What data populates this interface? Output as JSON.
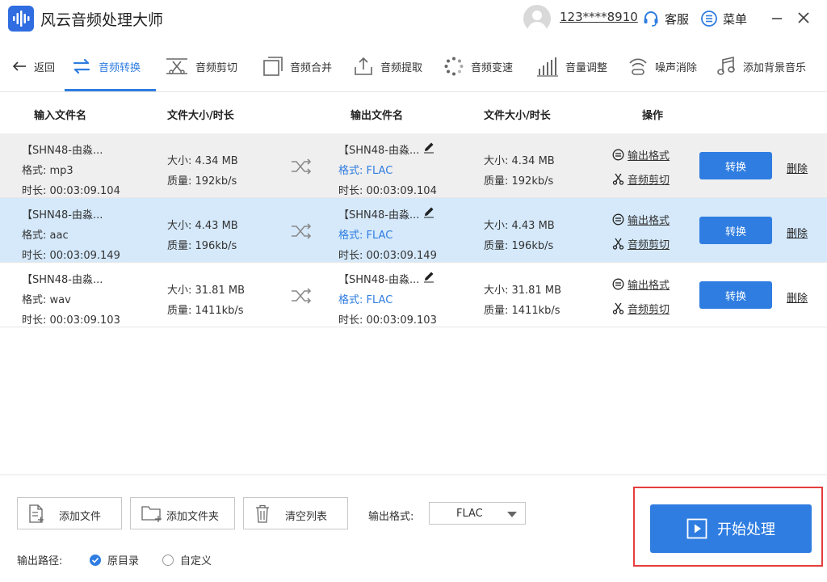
{
  "app": {
    "title": "风云音频处理大师"
  },
  "header": {
    "user": "123****8910",
    "service": "客服",
    "menu": "菜单"
  },
  "nav": {
    "back": "返回",
    "items": [
      "音频转换",
      "音频剪切",
      "音频合并",
      "音频提取",
      "音频变速",
      "音量调整",
      "噪声消除",
      "添加背景音乐"
    ],
    "active_index": 0
  },
  "table": {
    "headers": [
      "输入文件名",
      "文件大小/时长",
      "输出文件名",
      "文件大小/时长",
      "操作"
    ],
    "rows": [
      {
        "in_name": "【SHN48-由淼...",
        "in_fmt": "格式:  mp3",
        "in_dur": "时长:  00:03:09.104",
        "in_size": "大小:  4.34 MB",
        "in_quality": "质量:  192kb/s",
        "out_name": "【SHN48-由淼...",
        "out_fmt": "格式:  FLAC",
        "out_dur": "时长:  00:03:09.104",
        "out_size": "大小:  4.34 MB",
        "out_quality": "质量:  192kb/s",
        "op_format": "输出格式",
        "op_cut": "音频剪切",
        "convert": "转换",
        "delete": "删除"
      },
      {
        "in_name": "【SHN48-由淼...",
        "in_fmt": "格式:  aac",
        "in_dur": "时长:  00:03:09.149",
        "in_size": "大小:  4.43 MB",
        "in_quality": "质量:  196kb/s",
        "out_name": "【SHN48-由淼...",
        "out_fmt": "格式:  FLAC",
        "out_dur": "时长:  00:03:09.149",
        "out_size": "大小:  4.43 MB",
        "out_quality": "质量:  196kb/s",
        "op_format": "输出格式",
        "op_cut": "音频剪切",
        "convert": "转换",
        "delete": "删除"
      },
      {
        "in_name": "【SHN48-由淼...",
        "in_fmt": "格式:  wav",
        "in_dur": "时长:  00:03:09.103",
        "in_size": "大小:  31.81 MB",
        "in_quality": "质量:  1411kb/s",
        "out_name": "【SHN48-由淼...",
        "out_fmt": "格式:  FLAC",
        "out_dur": "时长:  00:03:09.103",
        "out_size": "大小:  31.81 MB",
        "out_quality": "质量:  1411kb/s",
        "op_format": "输出格式",
        "op_cut": "音频剪切",
        "convert": "转换",
        "delete": "删除"
      }
    ]
  },
  "bottom": {
    "add_file": "添加文件",
    "add_folder": "添加文件夹",
    "clear_list": "清空列表",
    "output_format_label": "输出格式:",
    "output_format_value": "FLAC",
    "output_path_label": "输出路径:",
    "path_options": [
      "原目录",
      "自定义"
    ],
    "path_selected": 0,
    "start": "开始处理"
  },
  "colors": {
    "accent": "#2f7de1",
    "row_gray": "#efefef",
    "row_selected": "#d5e9fb",
    "highlight": "#e53d3d"
  }
}
